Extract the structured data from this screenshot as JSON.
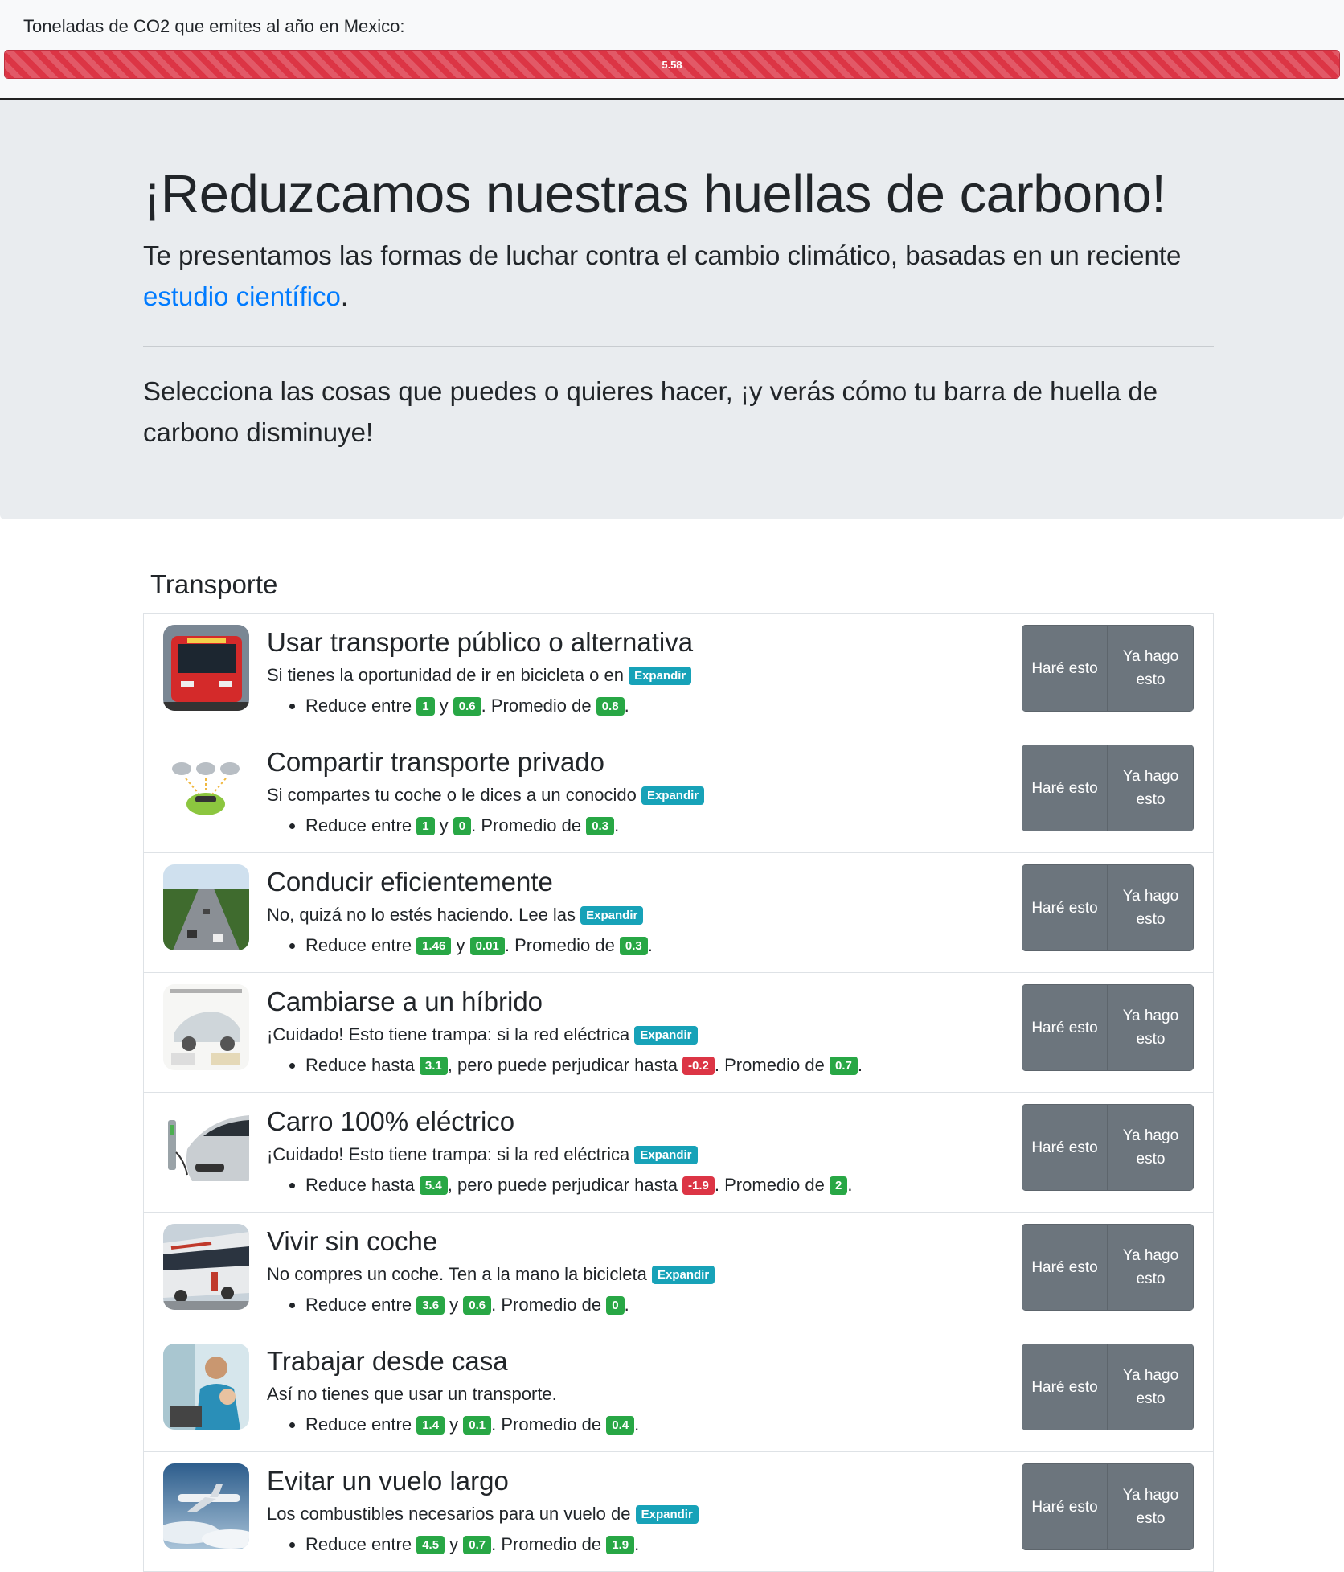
{
  "topbar": {
    "label": "Toneladas de CO2 que emites al año en Mexico:",
    "value": "5.58",
    "fill_fraction": 1.0
  },
  "hero": {
    "title": "¡Reduzcamos nuestras huellas de carbono!",
    "lead_text": "Te presentamos las formas de luchar contra el cambio climático, basadas en un reciente ",
    "lead_link": "estudio científico",
    "lead_end": ".",
    "instruction": "Selecciona las cosas que puedes o quieres hacer, ¡y verás cómo tu barra de huella de carbono disminuye!"
  },
  "section": {
    "title": "Transporte"
  },
  "labels": {
    "expand": "Expandir",
    "will_do": "Haré esto",
    "already_do": "Ya hago esto",
    "between": "Reduce entre ",
    "and": " y ",
    "avg": ". Promedio de ",
    "end": ".",
    "upto": "Reduce hasta ",
    "harm": ", pero puede perjudicar hasta "
  },
  "items": [
    {
      "title": "Usar transporte público o alternativa",
      "desc": "Si tienes la oportunidad de ir en bicicleta o en ",
      "a": "1",
      "b": "0.6",
      "avg": "0.8",
      "icon": "bus-icon"
    },
    {
      "title": "Compartir transporte privado",
      "desc": "Si compartes tu coche o le dices a un conocido ",
      "a": "1",
      "b": "0",
      "avg": "0.3",
      "icon": "carpool-icon"
    },
    {
      "title": "Conducir eficientemente",
      "desc": "No, quizá no lo estés haciendo. Lee las ",
      "a": "1.46",
      "b": "0.01",
      "avg": "0.3",
      "icon": "highway-icon"
    },
    {
      "title": "Cambiarse a un híbrido",
      "desc": "¡Cuidado! Esto tiene trampa: si la red eléctrica ",
      "a": "3.1",
      "b": "-0.2",
      "avg": "0.7",
      "icon": "hybrid-car-icon"
    },
    {
      "title": "Carro 100% eléctrico",
      "desc": "¡Cuidado! Esto tiene trampa: si la red eléctrica ",
      "a": "5.4",
      "b": "-1.9",
      "avg": "2",
      "icon": "electric-car-icon"
    },
    {
      "title": "Vivir sin coche",
      "desc": "No compres un coche. Ten a la mano la bicicleta ",
      "a": "3.6",
      "b": "0.6",
      "avg": "0",
      "icon": "city-bus-icon"
    },
    {
      "title": "Trabajar desde casa",
      "desc": "Así no tienes que usar un transporte.",
      "a": "1.4",
      "b": "0.1",
      "avg": "0.4",
      "icon": "home-office-icon"
    },
    {
      "title": "Evitar un vuelo largo",
      "desc": "Los combustibles necesarios para un vuelo de ",
      "a": "4.5",
      "b": "0.7",
      "avg": "1.9",
      "icon": "airplane-icon"
    }
  ]
}
